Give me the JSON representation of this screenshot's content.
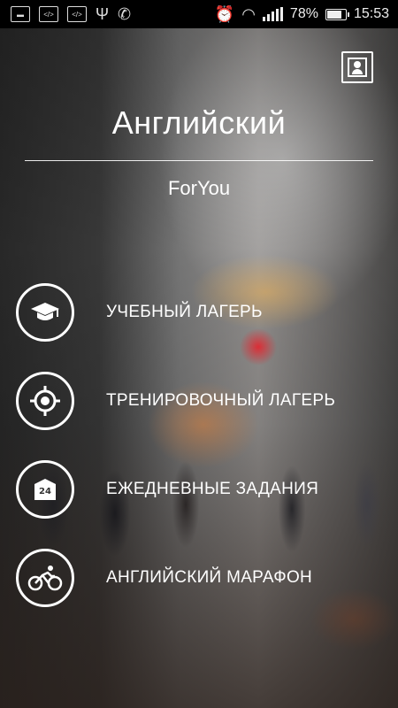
{
  "status_bar": {
    "battery": "78%",
    "time": "15:53",
    "left_icons": [
      "gallery-icon",
      "code-icon",
      "code-icon",
      "usb-icon",
      "missed-call-icon"
    ],
    "right_icons": [
      "alarm-icon",
      "wifi-icon",
      "signal-icon",
      "battery-charging-icon"
    ]
  },
  "header": {
    "title": "Английский",
    "subtitle": "ForYou",
    "profile_icon": "profile-card-icon"
  },
  "menu": [
    {
      "label": "УЧЕБНЫЙ ЛАГЕРЬ",
      "icon": "graduation-cap-icon"
    },
    {
      "label": "ТРЕНИРОВОЧНЫЙ ЛАГЕРЬ",
      "icon": "target-icon"
    },
    {
      "label": "ЕЖЕДНЕВНЫЕ ЗАДАНИЯ",
      "icon": "24h-store-icon"
    },
    {
      "label": "АНГЛИЙСКИЙ МАРАФОН",
      "icon": "cyclist-icon"
    }
  ],
  "colors": {
    "text": "#ffffff",
    "status_bar_bg": "#000000"
  }
}
